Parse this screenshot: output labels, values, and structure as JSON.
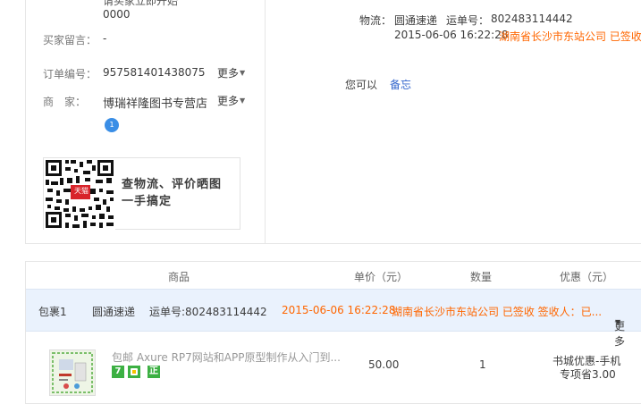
{
  "order": {
    "partial_top_line": "请买家立即开始",
    "partial_top_value": "0000",
    "buyer_message_label": "买家留言：",
    "buyer_message_value": "-",
    "order_no_label": "订单编号：",
    "order_no_value": "957581401438075",
    "more_label": "更多",
    "seller_label": "商　家：",
    "seller_value": "博瑞祥隆图书专营店",
    "bubble_text": "1"
  },
  "logistics": {
    "label": "物流：",
    "carrier": "圆通速递",
    "waybill_label": "运单号：",
    "waybill_no": "802483114442",
    "latest_time": "2015-06-06 16:22:28",
    "latest_status": "湖南省长沙市东站公司 已签收",
    "you_can": "您可以",
    "note_link": "备忘"
  },
  "qr_promo": {
    "line1": "查物流、评价晒图",
    "line2": "一手搞定",
    "tmall_tag": "天猫"
  },
  "table": {
    "headers": {
      "goods": "商品",
      "price": "单价（元）",
      "qty": "数量",
      "discount": "优惠（元）"
    },
    "package": {
      "name": "包裹1",
      "carrier": "圆通速递",
      "waybill": "运单号:802483114442",
      "time": "2015-06-06 16:22:28",
      "status": "湖南省长沙市东站公司 已签收 签收人：已...",
      "more": "更多"
    },
    "item": {
      "title": "包邮 Axure RP7网站和APP原型制作从入门到...",
      "price": "50.00",
      "qty": "1",
      "discount_line1": "书城优惠-手机",
      "discount_line2": "专项省3.00",
      "badge1": "7",
      "badge3": "正"
    }
  },
  "colors": {
    "orange": "#ff6600",
    "link": "#3366cc",
    "badge_green": "#3cb043"
  }
}
